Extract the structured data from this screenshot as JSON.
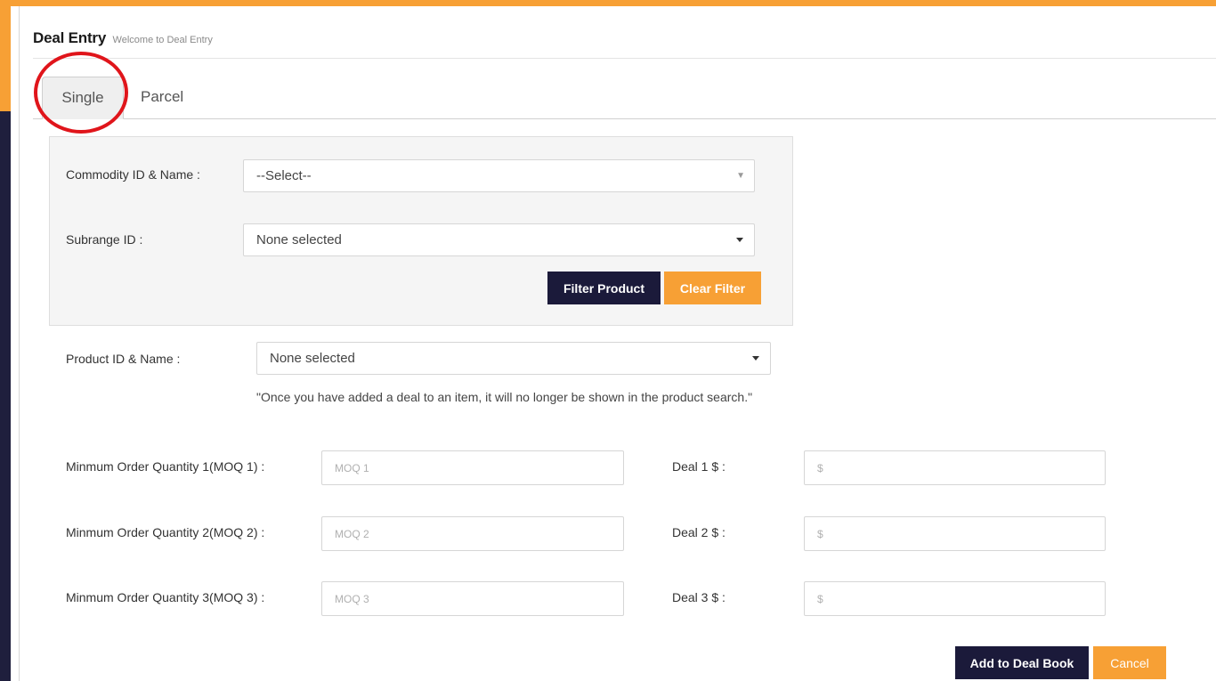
{
  "header": {
    "title": "Deal Entry",
    "subtitle": "Welcome to Deal Entry"
  },
  "tabs": [
    {
      "label": "Single",
      "active": true
    },
    {
      "label": "Parcel",
      "active": false
    }
  ],
  "filters": {
    "commodity": {
      "label": "Commodity ID & Name :",
      "value": "--Select--"
    },
    "subrange": {
      "label": "Subrange ID :",
      "value": "None selected"
    },
    "filter_button": "Filter Product",
    "clear_button": "Clear Filter"
  },
  "product": {
    "label": "Product ID & Name :",
    "value": "None selected",
    "note": "\"Once you have added a deal to an item, it will no longer be shown in the product search.\""
  },
  "moq_rows": [
    {
      "moq_label": "Minmum Order Quantity 1(MOQ 1) :",
      "moq_placeholder": "MOQ 1",
      "deal_label": "Deal 1 $ :",
      "deal_placeholder": "$"
    },
    {
      "moq_label": "Minmum Order Quantity 2(MOQ 2) :",
      "moq_placeholder": "MOQ 2",
      "deal_label": "Deal 2 $ :",
      "deal_placeholder": "$"
    },
    {
      "moq_label": "Minmum Order Quantity 3(MOQ 3) :",
      "moq_placeholder": "MOQ 3",
      "deal_label": "Deal 3 $ :",
      "deal_placeholder": "$"
    }
  ],
  "actions": {
    "add": "Add to Deal Book",
    "cancel": "Cancel"
  },
  "colors": {
    "accent": "#f7a035",
    "dark": "#1b1a3a",
    "annotation": "#e0151b"
  }
}
